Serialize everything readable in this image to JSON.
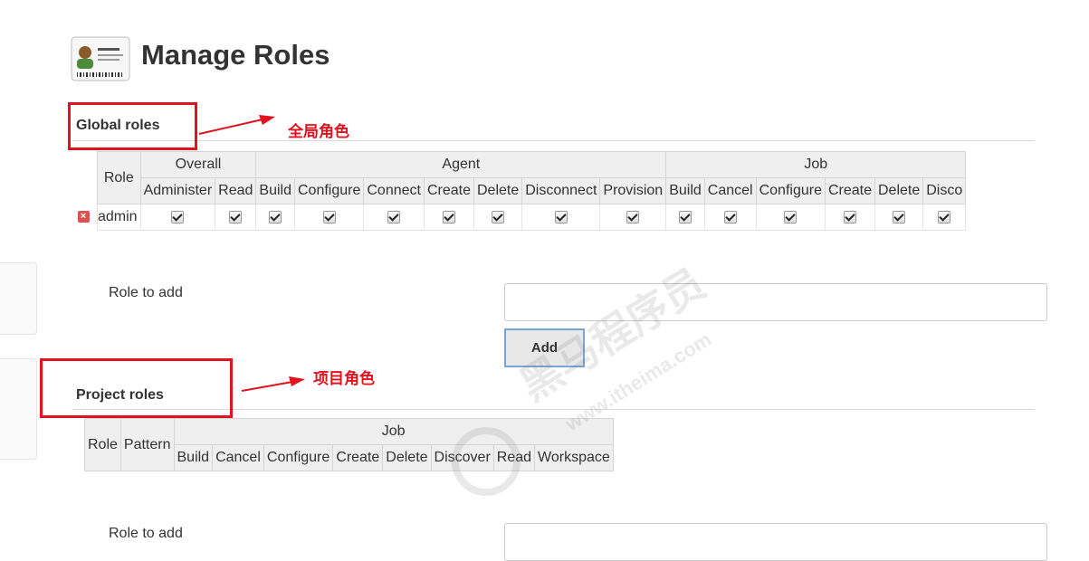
{
  "page": {
    "title": "Manage Roles"
  },
  "global": {
    "heading": "Global roles",
    "annotation": "全局角色",
    "groups": [
      {
        "label": "Overall",
        "perms": [
          "Administer",
          "Read"
        ]
      },
      {
        "label": "Agent",
        "perms": [
          "Build",
          "Configure",
          "Connect",
          "Create",
          "Delete",
          "Disconnect",
          "Provision"
        ]
      },
      {
        "label": "Job",
        "perms": [
          "Build",
          "Cancel",
          "Configure",
          "Create",
          "Delete",
          "Disco"
        ]
      }
    ],
    "role_header": "Role",
    "rows": [
      {
        "name": "admin",
        "checked": true
      }
    ],
    "form": {
      "label": "Role to add",
      "value": "",
      "add_label": "Add"
    }
  },
  "project": {
    "heading": "Project roles",
    "annotation": "项目角色",
    "role_header": "Role",
    "pattern_header": "Pattern",
    "group": "Job",
    "perms": [
      "Build",
      "Cancel",
      "Configure",
      "Create",
      "Delete",
      "Discover",
      "Read",
      "Workspace"
    ],
    "form": {
      "label": "Role to add"
    }
  },
  "watermark": {
    "text": "黑马程序员",
    "sub": "www.itheima.com"
  },
  "colors": {
    "annotation_red": "#e0131f",
    "button_border": "#7aa3d6",
    "header_bg": "#efefef"
  }
}
